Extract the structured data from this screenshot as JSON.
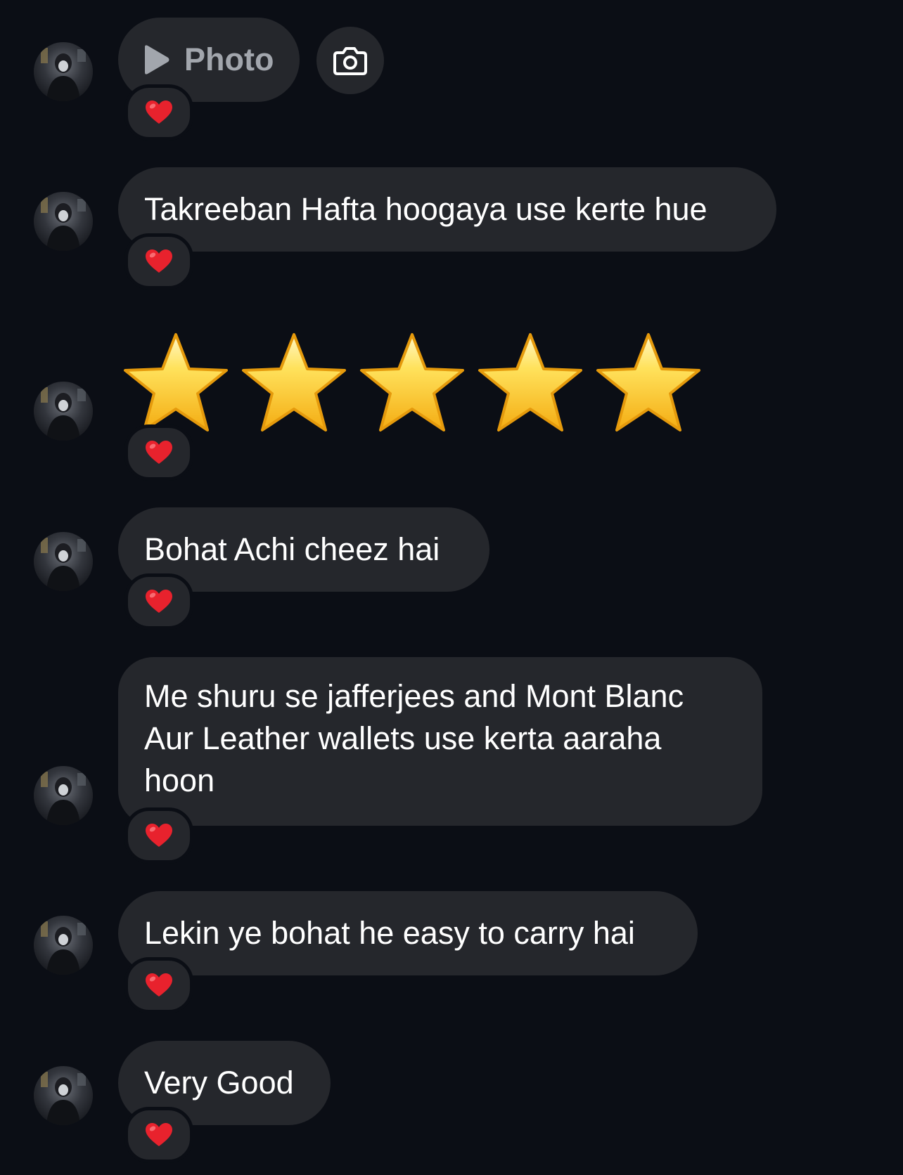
{
  "messages": [
    {
      "type": "photo",
      "label": "Photo",
      "reaction": "heart"
    },
    {
      "type": "text",
      "text": "Takreeban Hafta hoogaya use kerte hue",
      "reaction": "heart"
    },
    {
      "type": "emoji",
      "text": "⭐⭐⭐⭐⭐",
      "count": 5,
      "reaction": "heart"
    },
    {
      "type": "text",
      "text": "Bohat Achi cheez hai",
      "reaction": "heart"
    },
    {
      "type": "text",
      "lines": [
        "Me shuru se jafferjees and Mont Blanc",
        "Aur Leather wallets use kerta aaraha",
        "hoon"
      ],
      "reaction": "heart"
    },
    {
      "type": "text",
      "text": "Lekin ye bohat he easy to carry hai",
      "reaction": "heart"
    },
    {
      "type": "text",
      "text": "Very Good",
      "reaction": "heart"
    }
  ],
  "colors": {
    "background": "#0b0e15",
    "bubble": "#25272c",
    "text": "#ffffff",
    "muted": "#a2a6ad",
    "heart": "#e8222d",
    "star": "#fbc21e"
  },
  "icons": {
    "play": "play-icon",
    "camera": "camera-icon",
    "heart": "heart-icon",
    "star": "star-icon"
  }
}
